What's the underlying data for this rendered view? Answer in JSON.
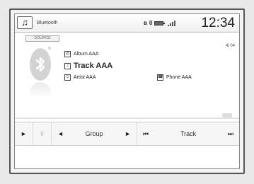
{
  "statusbar": {
    "app_icon": "music-note-icon",
    "title": "Bluetooth",
    "status_num": "0",
    "clock": "12:34"
  },
  "source": {
    "label": "SOURCE",
    "logo": "bluetooth-icon"
  },
  "now_playing": {
    "track_number": "4l 04",
    "album": "Album AAA",
    "track": "Track AAA",
    "artist": "Artist AAA",
    "phone": "Phone AAA"
  },
  "controls": {
    "play": "►",
    "pause": "II",
    "group_prev": "◄",
    "group_label": "Group",
    "group_next": "►",
    "track_prev": "⏮",
    "track_label": "Track",
    "track_next": "⏭"
  }
}
